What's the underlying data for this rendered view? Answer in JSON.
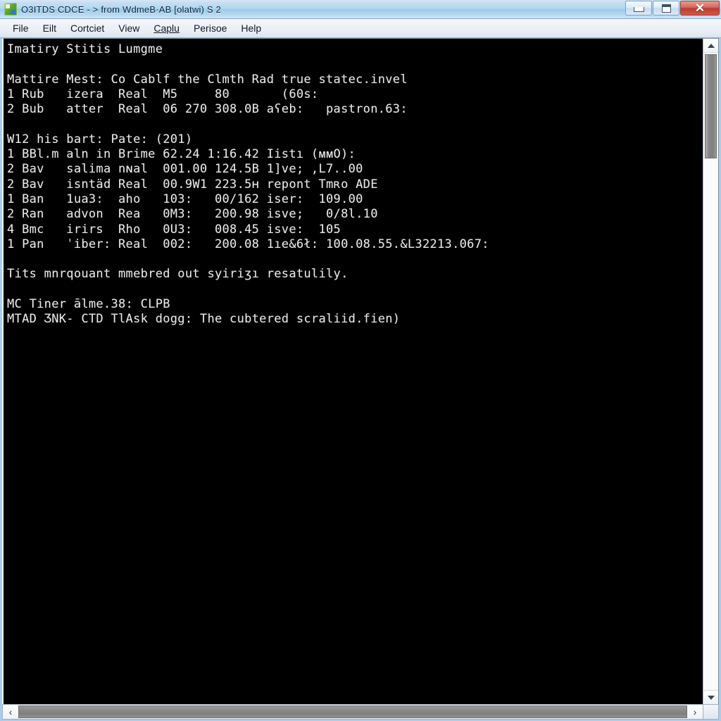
{
  "window": {
    "title": "O3ITDS CDCE - > from WdmeB·AB [olatwi) S 2",
    "icon": "app-icon",
    "controls": {
      "minimize": "–",
      "maximize": "□",
      "close": "✕"
    }
  },
  "menu": {
    "items": [
      {
        "label": "File",
        "accel": "F"
      },
      {
        "label": "Eilt",
        "accel": ""
      },
      {
        "label": "Cortciet",
        "accel": ""
      },
      {
        "label": "View",
        "accel": ""
      },
      {
        "label": "Caplu",
        "accel": "C"
      },
      {
        "label": "Perisoe",
        "accel": ""
      },
      {
        "label": "Help",
        "accel": ""
      }
    ]
  },
  "terminal": {
    "lines": [
      "Imatiry Stitis Lumgme",
      "",
      "Mattire Mest: Co Cablf the Clmth Rad true statec.invel",
      "1 Rub   izera  Real  M5     80       (60s:",
      "2 Bub   atter  Real  06 270 308.0B aʕeb:   pastron.63:",
      "",
      "W12 his bart: Pate: (201)",
      "1 BBl.m aln in Brime 62.24 1:16.42 Iistı (ᴍᴍO):",
      "2 Bav   salima nɴal  001.00 124.5B 1]ve; ,L7..00",
      "2 Bav   isntäd Real  00.9W1 223.5ʜ repont Tmʀo ADE",
      "1 Ban   1ua3:  aho   103:   00/162 iser:  109.00",
      "2 Ran   advon  Rea   0M3:   200.98 isve;   0/8l.10",
      "4 Bmc   irirs  Rho   0U3:   008.45 isve:  105",
      "1 Pan   ˈiber: Real  002:   200.08 1ıe&6ł: 100.08.55.&L32213.067:",
      "",
      "Tits mnrqouant mmebred out syiriʒı resatulily.",
      "",
      "MC Tiner ālme.38: CLPB",
      "MTAD ƷNK- CTD TlAsk dogg: The cubtered scraliid.fien)"
    ]
  },
  "scrollbars": {
    "vertical": {
      "up": "▲",
      "down": "▼",
      "thumb_position": "top"
    },
    "horizontal": {
      "left": "‹",
      "right": "›",
      "thumb_position": "full"
    }
  },
  "colors": {
    "title_bar": "#aecbe8",
    "terminal_bg": "#000000",
    "terminal_fg": "#e8e8e8",
    "close_button": "#bb3d2e",
    "scrollbar_thumb": "#878787"
  }
}
